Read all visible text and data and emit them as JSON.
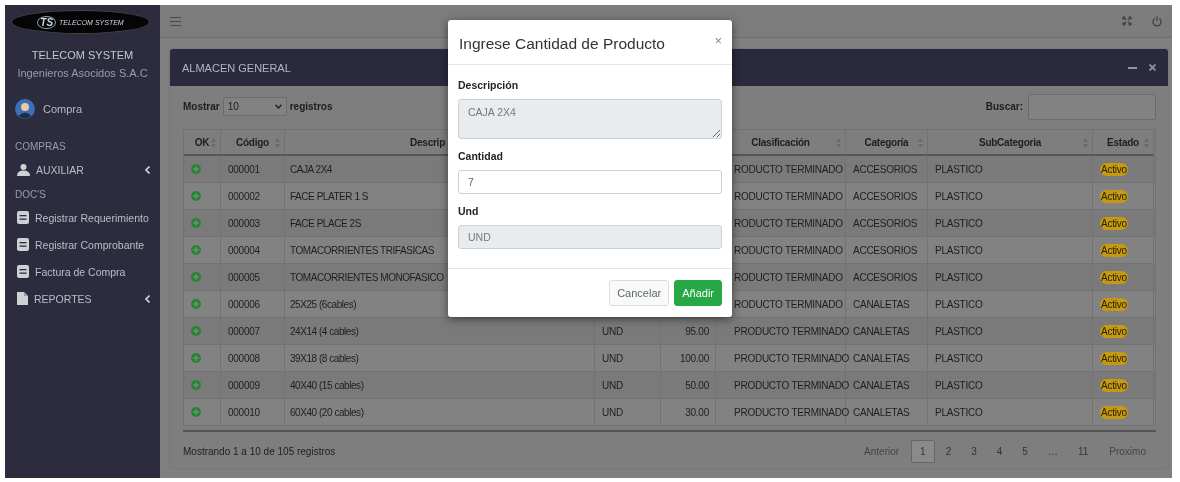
{
  "sidebar": {
    "logo_mark": "TS",
    "logo_text": "TELECOM SYSTEM",
    "company": "TELECOM SYSTEM",
    "subtitle": "Ingenieros Asocidos S.A.C",
    "user": "Compra",
    "items": [
      {
        "kind": "header",
        "label": "COMPRAS"
      },
      {
        "kind": "user",
        "label": "AUXILIAR",
        "expandable": true
      },
      {
        "kind": "header",
        "label": "DOC'S"
      },
      {
        "kind": "document",
        "label": "Registrar Requerimiento",
        "expandable": false
      },
      {
        "kind": "document",
        "label": "Registrar Comprobante",
        "expandable": false
      },
      {
        "kind": "document",
        "label": "Factura de Compra",
        "expandable": false
      },
      {
        "kind": "file",
        "label": "REPORTES",
        "expandable": true
      }
    ]
  },
  "card": {
    "title": "ALMACEN GENERAL",
    "length": {
      "before": "Mostrar",
      "value": "10",
      "after": "registros"
    },
    "search": {
      "label": "Buscar:"
    },
    "columns": [
      {
        "label": "OK"
      },
      {
        "label": "Código"
      },
      {
        "label": "Descrip"
      },
      {
        "label": "Clasificación"
      },
      {
        "label": "Categoría"
      },
      {
        "label": "SubCategoria"
      },
      {
        "label": "Estado"
      }
    ],
    "rows": [
      {
        "code": "000001",
        "description": "CAJA 2X4",
        "classification": "RODUCTO TERMINADO",
        "category": "ACCESORIOS",
        "subcategory": "PLASTICO",
        "status": "Activo"
      },
      {
        "code": "000002",
        "description": "FACE PLATER 1 S",
        "classification": "RODUCTO TERMINADO",
        "category": "ACCESORIOS",
        "subcategory": "PLASTICO",
        "status": "Activo"
      },
      {
        "code": "000003",
        "description": "FACE PLACE 2S",
        "classification": "RODUCTO TERMINADO",
        "category": "ACCESORIOS",
        "subcategory": "PLASTICO",
        "status": "Activo"
      },
      {
        "code": "000004",
        "description": "TOMACORRIENTES TRIFASICAS",
        "classification": "RODUCTO TERMINADO",
        "category": "ACCESORIOS",
        "subcategory": "PLASTICO",
        "status": "Activo"
      },
      {
        "code": "000005",
        "description": "TOMACORRIENTES MONOFASICO",
        "classification": "RODUCTO TERMINADO",
        "category": "ACCESORIOS",
        "subcategory": "PLASTICO",
        "status": "Activo"
      },
      {
        "code": "000006",
        "description": "25X25 (6cables)",
        "classification": "RODUCTO TERMINADO",
        "category": "CANALETAS",
        "subcategory": "PLASTICO",
        "status": "Activo"
      },
      {
        "code": "000007",
        "description": "24X14 (4 cables)",
        "unit": "UND",
        "amount": "95.00",
        "classification": "PRODUCTO TERMINADO",
        "category": "CANALETAS",
        "subcategory": "PLASTICO",
        "status": "Activo"
      },
      {
        "code": "000008",
        "description": "39X18 (8 cables)",
        "unit": "UND",
        "amount": "100.00",
        "classification": "PRODUCTO TERMINADO",
        "category": "CANALETAS",
        "subcategory": "PLASTICO",
        "status": "Activo"
      },
      {
        "code": "000009",
        "description": "40X40 (15 cables)",
        "unit": "UND",
        "amount": "50.00",
        "classification": "PRODUCTO TERMINADO",
        "category": "CANALETAS",
        "subcategory": "PLASTICO",
        "status": "Activo"
      },
      {
        "code": "000010",
        "description": "60X40 (20 cables)",
        "unit": "UND",
        "amount": "30.00",
        "classification": "PRODUCTO TERMINADO",
        "category": "CANALETAS",
        "subcategory": "PLASTICO",
        "status": "Activo"
      }
    ],
    "info": "Mostrando 1 a 10 de 105 registros",
    "pagination": {
      "previous": "Anterior",
      "pages": [
        {
          "label": "1",
          "selected": true
        },
        {
          "label": "2",
          "selected": false
        },
        {
          "label": "3",
          "selected": false
        },
        {
          "label": "4",
          "selected": false
        },
        {
          "label": "5",
          "selected": false
        },
        {
          "label": "…",
          "selected": false
        },
        {
          "label": "11",
          "selected": false
        }
      ],
      "next": "Proximo"
    }
  },
  "modal": {
    "title": "Ingrese Cantidad de Producto",
    "close": "×",
    "fields": [
      {
        "kind": "textarea",
        "label": "Descripción",
        "value": "CAJA 2X4",
        "disabled": true
      },
      {
        "kind": "input",
        "label": "Cantidad",
        "value": "7",
        "disabled": false
      },
      {
        "kind": "input",
        "label": "Und",
        "value": "UND",
        "disabled": true
      }
    ],
    "buttons": [
      {
        "kind": "secondary",
        "label": "Cancelar"
      },
      {
        "kind": "primary",
        "label": "Añadir"
      }
    ]
  }
}
